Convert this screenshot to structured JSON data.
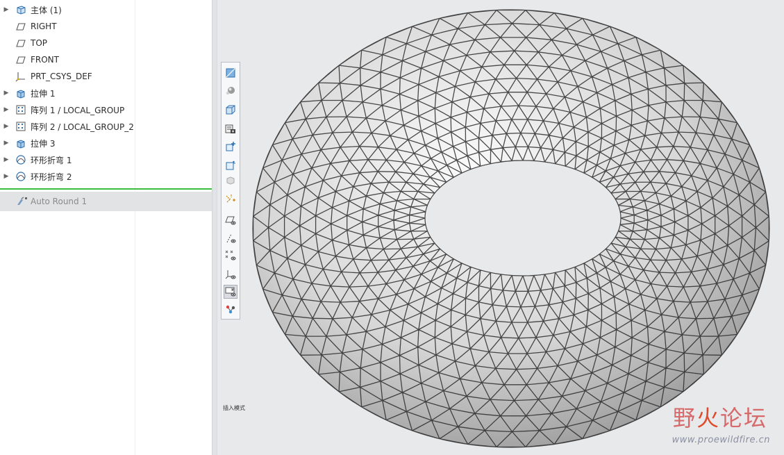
{
  "model_tree": {
    "items": [
      {
        "label": "主体 (1)",
        "expandable": true,
        "icon": "body-icon"
      },
      {
        "label": "RIGHT",
        "expandable": false,
        "icon": "datum-plane-icon"
      },
      {
        "label": "TOP",
        "expandable": false,
        "icon": "datum-plane-icon"
      },
      {
        "label": "FRONT",
        "expandable": false,
        "icon": "datum-plane-icon"
      },
      {
        "label": "PRT_CSYS_DEF",
        "expandable": false,
        "icon": "coordinate-system-icon"
      },
      {
        "label": "拉伸 1",
        "expandable": true,
        "icon": "extrude-icon"
      },
      {
        "label": "阵列 1 / LOCAL_GROUP",
        "expandable": true,
        "icon": "pattern-icon"
      },
      {
        "label": "阵列 2 / LOCAL_GROUP_2",
        "expandable": true,
        "icon": "pattern-icon"
      },
      {
        "label": "拉伸 3",
        "expandable": true,
        "icon": "extrude-icon"
      },
      {
        "label": "环形折弯 1",
        "expandable": true,
        "icon": "toroidal-bend-icon"
      },
      {
        "label": "环形折弯 2",
        "expandable": true,
        "icon": "toroidal-bend-icon"
      }
    ],
    "auto_round": {
      "label": "Auto Round 1",
      "icon": "auto-round-icon"
    }
  },
  "view_toolbar": {
    "buttons": [
      {
        "name": "refit-icon"
      },
      {
        "name": "shading-icon"
      },
      {
        "name": "view-cube-icon"
      },
      {
        "name": "saved-views-icon"
      },
      {
        "name": "zoom-in-icon"
      },
      {
        "name": "zoom-box-icon"
      },
      {
        "name": "display-style-icon"
      },
      {
        "name": "spin-center-icon"
      },
      {
        "name": "plane-display-icon"
      },
      {
        "name": "axis-display-icon"
      },
      {
        "name": "point-display-icon"
      },
      {
        "name": "csys-display-icon"
      },
      {
        "name": "annotation-display-icon",
        "active": true
      },
      {
        "name": "connections-icon"
      }
    ]
  },
  "viewport": {
    "mode_label": "插入模式"
  },
  "watermark": {
    "title_a": "野",
    "title_b": "火",
    "title_c": "论坛",
    "url": "www.proewildfire.cn"
  },
  "colors": {
    "insert_line": "#3bbd3b",
    "watermark": "#d66a6a"
  }
}
